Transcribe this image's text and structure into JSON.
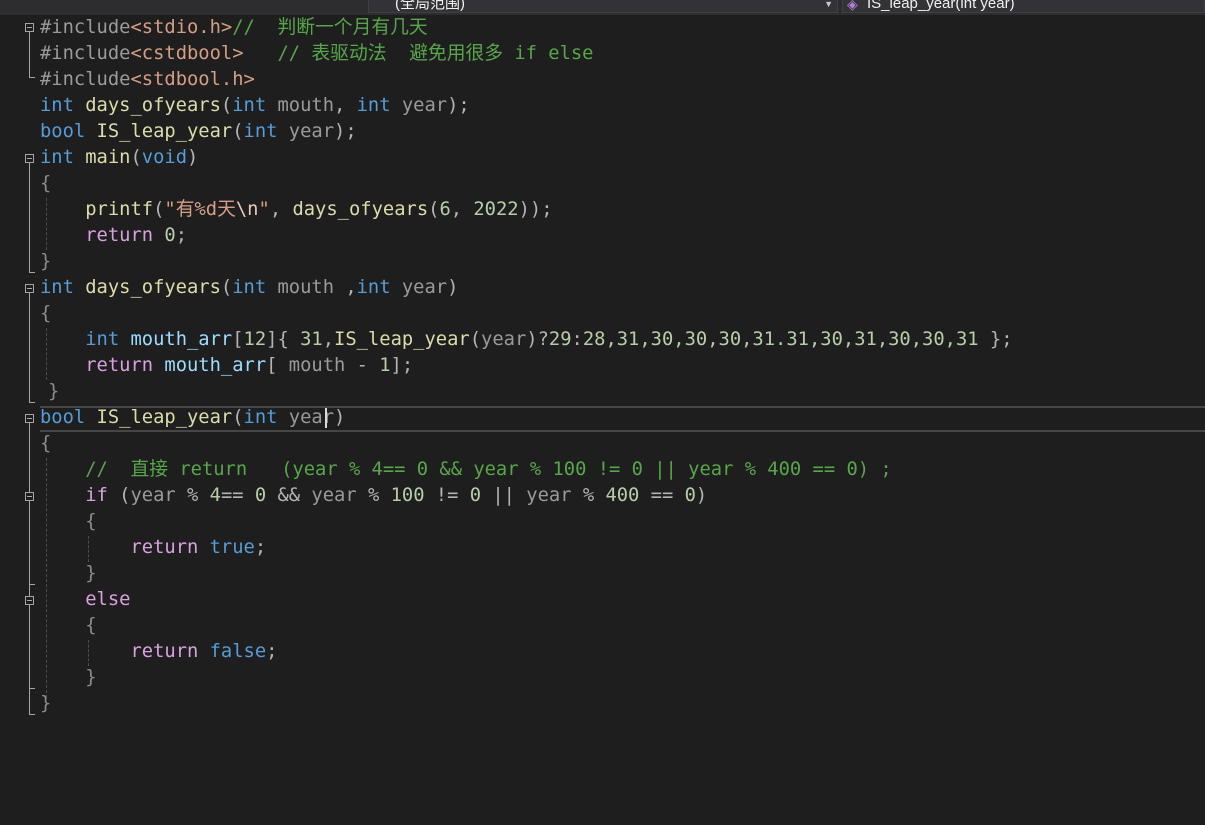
{
  "navigation_bar": {
    "scope_dropdown": "(全局范围)",
    "member_dropdown": "IS_leap_year(int year)"
  },
  "code": {
    "l1": {
      "inc": "#include",
      "hdr": "<stdio.h>",
      "cmt": "//  判断一个月有几天"
    },
    "l2": {
      "inc": "#include",
      "hdr": "<cstdbool>",
      "gap": "   ",
      "cmt": "// 表驱动法  避免用很多 if else"
    },
    "l3": {
      "inc": "#include",
      "hdr": "<stdbool.h>"
    },
    "l4": {
      "t1": "int",
      "fn": " days_ofyears",
      "p1": "(",
      "t2": "int",
      "a1": " mouth",
      "c1": ", ",
      "t3": "int",
      "a2": " year",
      "end": ");"
    },
    "l5": {
      "t1": "bool",
      "fn": " IS_leap_year",
      "p1": "(",
      "t2": "int",
      "a1": " year",
      "end": ");"
    },
    "l6": {
      "t1": "int",
      "fn": " main",
      "p1": "(",
      "t2": "void",
      "end": ")"
    },
    "l7": {
      "brace": "{"
    },
    "l8": {
      "fn": "printf",
      "p1": "(",
      "s1": "\"有%d天",
      "esc": "\\n",
      "s2": "\"",
      "c1": ", ",
      "fn2": "days_ofyears",
      "p2": "(",
      "n1": "6",
      "c2": ", ",
      "n2": "2022",
      "end": "));"
    },
    "l9": {
      "kw": "return",
      "sp": " ",
      "n1": "0",
      "end": ";"
    },
    "l10": {
      "brace": "}"
    },
    "l11": {
      "t1": "int",
      "fn": " days_ofyears",
      "p1": "(",
      "t2": "int",
      "a1": " mouth ",
      "c1": ",",
      "t3": "int",
      "a2": " year",
      "end": ")"
    },
    "l12": {
      "brace": "{"
    },
    "l13": {
      "t1": "int",
      "v1": " mouth_arr",
      "b1": "[",
      "n1": "12",
      "b2": "]{ ",
      "n2": "31",
      "c1": ",",
      "fn": "IS_leap_year",
      "p1": "(",
      "a1": "year",
      "p2": ")",
      "q": "?",
      "n3": "29",
      "col": ":",
      "n4": "28,31,30,30,30,31.31,30,31,30,30,31",
      "end": " };"
    },
    "l14": {
      "kw": "return",
      "v1": " mouth_arr",
      "b1": "[",
      "a1": " mouth",
      "op": " - ",
      "n1": "1",
      "end": "];"
    },
    "l15": {
      "brace": "}"
    },
    "l16": {
      "t1": "bool",
      "fn": " IS_leap_year",
      "p1": "(",
      "t2": "int",
      "a1": " year",
      "end": ")"
    },
    "l17": {
      "brace": "{"
    },
    "l18": {
      "cmt": "//  直接 return   (year % 4== 0 && year % 100 != 0 || year % 400 == 0) ;"
    },
    "l19": {
      "kw": "if",
      "p1": " (",
      "a1": "year",
      "o1": " % ",
      "n1": "4",
      "o2": "== ",
      "n2": "0",
      "o3": " && ",
      "a2": "year",
      "o4": " % ",
      "n3": "100",
      "o5": " != ",
      "n4": "0",
      "o6": " || ",
      "a3": "year",
      "o7": " % ",
      "n5": "400",
      "o8": " == ",
      "n6": "0",
      "end": ")"
    },
    "l20": {
      "brace": "{"
    },
    "l21": {
      "kw": "return",
      "sp": " ",
      "v": "true",
      "end": ";"
    },
    "l22": {
      "brace": "}"
    },
    "l23": {
      "kw": "else"
    },
    "l24": {
      "brace": "{"
    },
    "l25": {
      "kw": "return",
      "sp": " ",
      "v": "false",
      "end": ";"
    },
    "l26": {
      "brace": "}"
    },
    "l27": {
      "brace": "}"
    }
  },
  "colors": {
    "background": "#1e1e1e",
    "keyword": "#569cd6",
    "function": "#dcdcaa",
    "comment": "#57a64a",
    "string": "#d69d85",
    "number": "#b5cea8",
    "parameter": "#9a9a9a",
    "control": "#d8a0df",
    "preprocessor": "#9b9b9b"
  },
  "icons": {
    "member_icon": "purple-method-cube-icon",
    "fold_toggle": "collapse-minus-box-icon"
  }
}
